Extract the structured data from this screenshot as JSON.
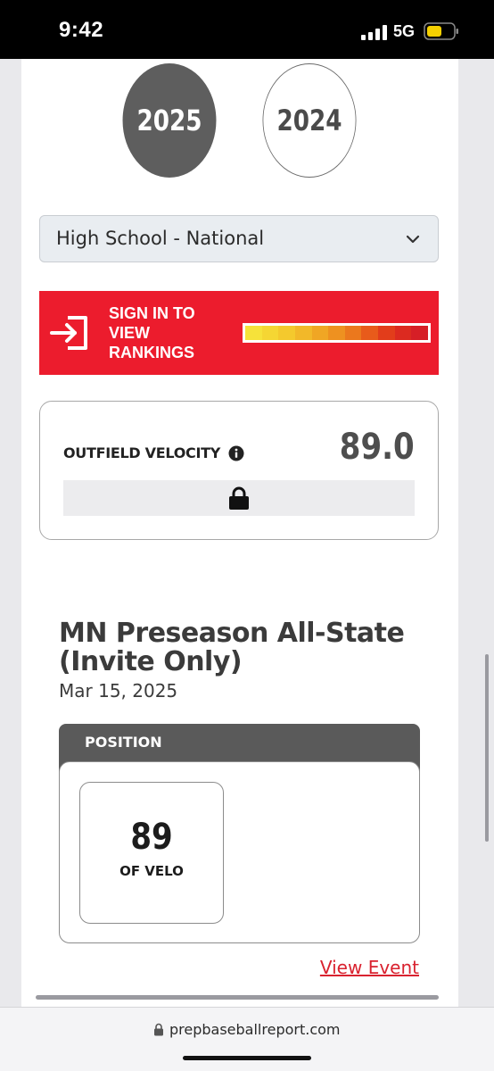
{
  "status_bar": {
    "time": "9:42",
    "network": "5G",
    "battery_color": "#f5d000"
  },
  "years": {
    "active": "2025",
    "inactive": "2024"
  },
  "level_select": {
    "value": "High School - National"
  },
  "signin_banner": {
    "text": "SIGN IN TO VIEW RANKINGS",
    "bg_color": "#ec1c2d",
    "meter_colors": [
      "#f6e23a",
      "#f5d633",
      "#f4c92d",
      "#f2b829",
      "#f0a624",
      "#ee9120",
      "#eb781d",
      "#e85b1b",
      "#e23d1b",
      "#dc2a20",
      "#d61f26"
    ]
  },
  "velocity_card": {
    "label": "OUTFIELD VELOCITY",
    "value": "89.0",
    "locked": true
  },
  "event": {
    "title": "MN Preseason All-State (Invite Only)",
    "date": "Mar 15, 2025",
    "position_header": "POSITION",
    "stat_value": "89",
    "stat_label": "OF VELO",
    "link_label": "View Event"
  },
  "browser": {
    "url": "prepbaseballreport.com"
  }
}
